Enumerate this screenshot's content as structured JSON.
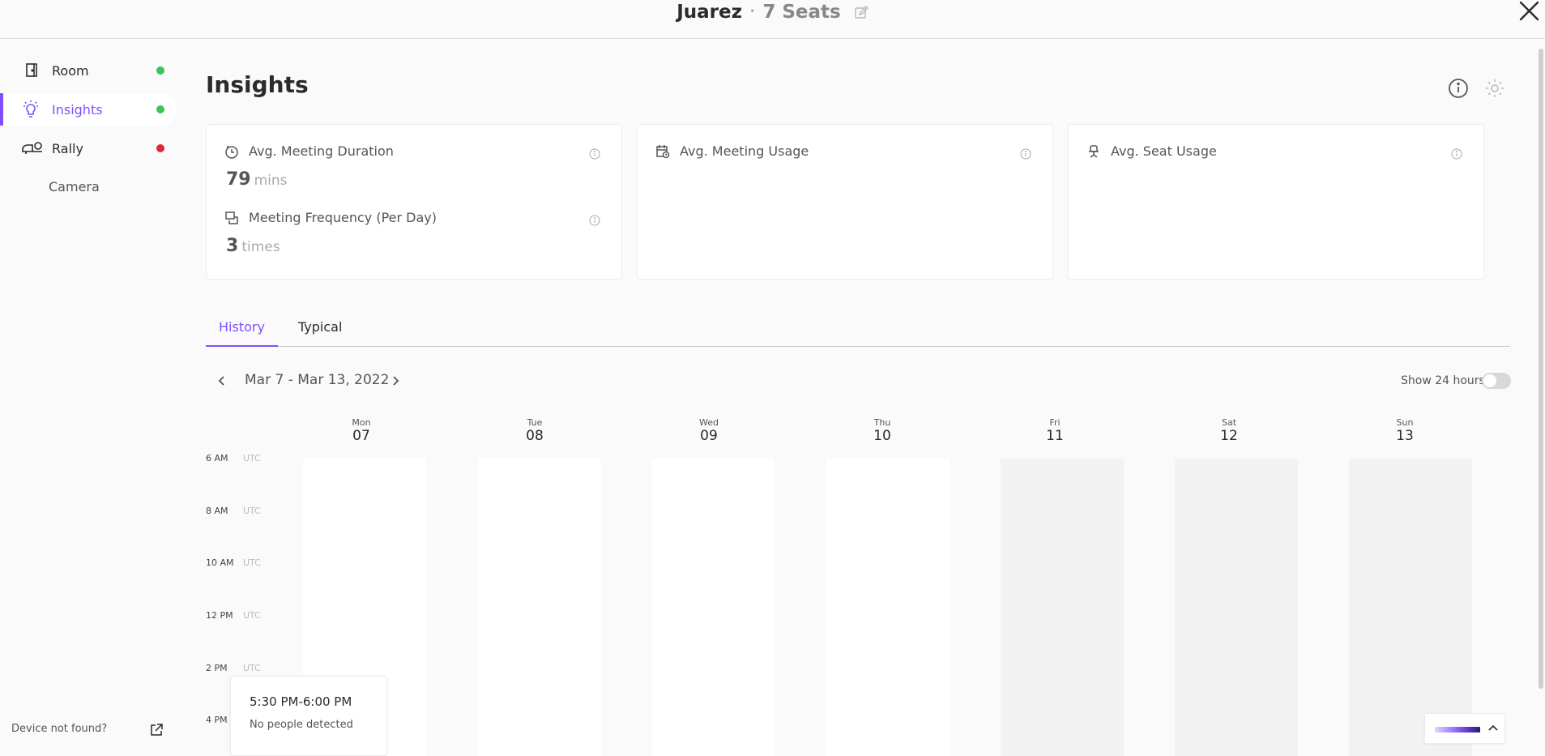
{
  "header": {
    "room_name": "Juarez",
    "separator": "·",
    "seats": "7 Seats"
  },
  "sidebar": {
    "items": [
      {
        "label": "Room",
        "status_color": "#3cc456"
      },
      {
        "label": "Insights",
        "status_color": "#3cc456"
      },
      {
        "label": "Rally",
        "status_color": "#e0273a"
      }
    ],
    "sub_item": "Camera",
    "device_not_found": "Device not found?"
  },
  "main": {
    "title": "Insights",
    "cards": [
      {
        "label": "Avg. Meeting Duration",
        "value": "79",
        "unit": "mins",
        "label2": "Meeting Frequency (Per Day)",
        "value2": "3",
        "unit2": "times"
      },
      {
        "label": "Avg. Meeting Usage"
      },
      {
        "label": "Avg. Seat Usage"
      }
    ],
    "tabs": [
      {
        "label": "History",
        "active": true
      },
      {
        "label": "Typical",
        "active": false
      }
    ],
    "date_range": "Mar 7 - Mar 13, 2022",
    "show24_label": "Show 24 hours",
    "show24_on": false,
    "days": [
      {
        "dow": "Mon",
        "num": "07"
      },
      {
        "dow": "Tue",
        "num": "08"
      },
      {
        "dow": "Wed",
        "num": "09"
      },
      {
        "dow": "Thu",
        "num": "10"
      },
      {
        "dow": "Fri",
        "num": "11"
      },
      {
        "dow": "Sat",
        "num": "12"
      },
      {
        "dow": "Sun",
        "num": "13"
      }
    ],
    "times": [
      "6 AM",
      "8 AM",
      "10 AM",
      "12 PM",
      "2 PM",
      "4 PM"
    ],
    "tz": "UTC",
    "tooltip": {
      "time": "5:30 PM-6:00 PM",
      "message": "No people detected"
    }
  },
  "colors": {
    "accent": "#814eff",
    "status_green": "#3cc456",
    "status_red": "#e0273a"
  }
}
